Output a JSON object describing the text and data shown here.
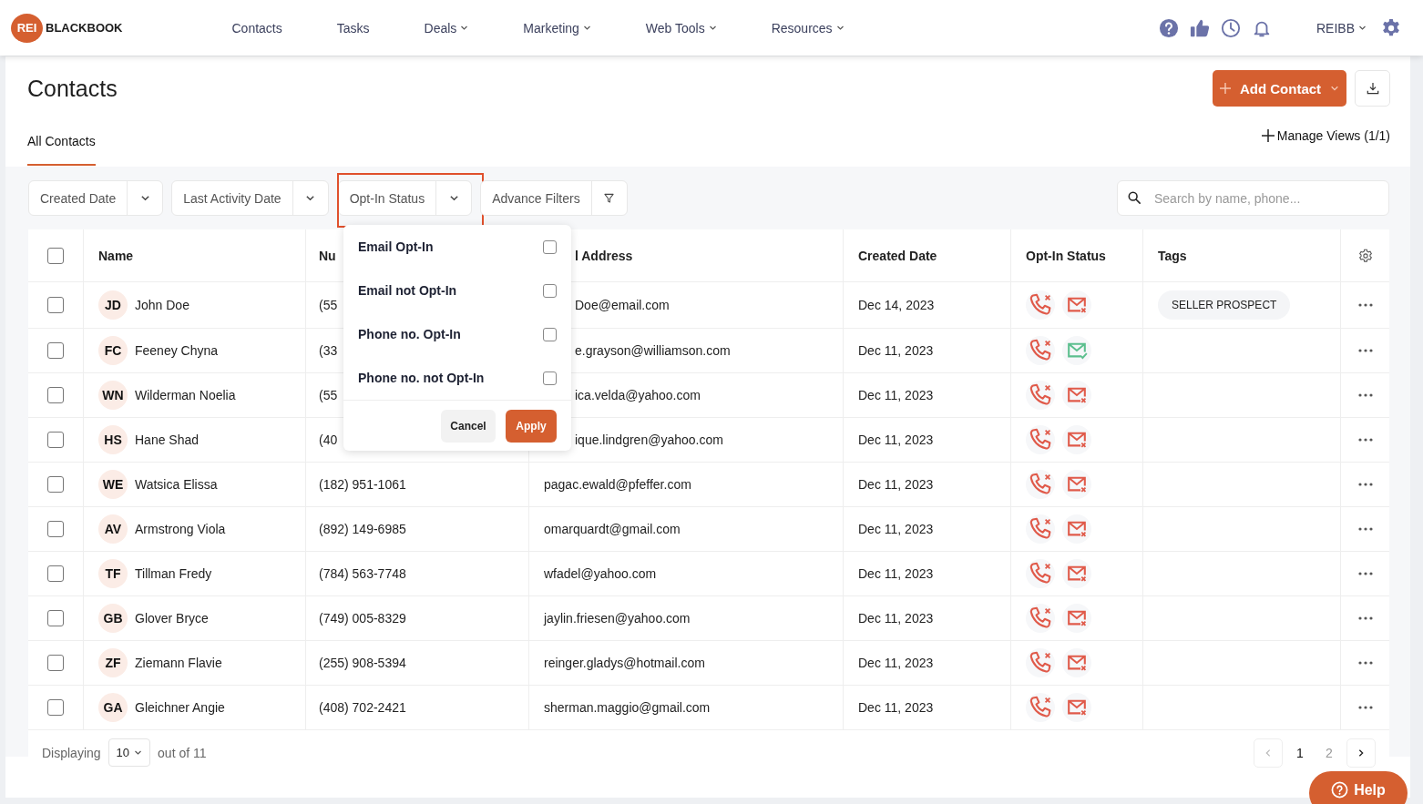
{
  "brand": {
    "badge": "REI",
    "name": "BLACKBOOK"
  },
  "nav": [
    {
      "label": "Contacts",
      "dropdown": false
    },
    {
      "label": "Tasks",
      "dropdown": false
    },
    {
      "label": "Deals",
      "dropdown": true
    },
    {
      "label": "Marketing",
      "dropdown": true
    },
    {
      "label": "Web Tools",
      "dropdown": true
    },
    {
      "label": "Resources",
      "dropdown": true
    }
  ],
  "user": {
    "label": "REIBB"
  },
  "page": {
    "title": "Contacts",
    "add_button": "Add Contact",
    "manage_views": "Manage Views (1/1)"
  },
  "view_tabs": [
    {
      "label": "All Contacts",
      "selected": true
    }
  ],
  "filters": [
    {
      "label": "Created Date",
      "kind": "dropdown",
      "highlighted": false
    },
    {
      "label": "Last Activity Date",
      "kind": "dropdown",
      "highlighted": false
    },
    {
      "label": "Opt-In Status",
      "kind": "dropdown",
      "highlighted": true
    },
    {
      "label": "Advance Filters",
      "kind": "filter",
      "highlighted": false
    }
  ],
  "search": {
    "placeholder": "Search by name, phone..."
  },
  "table": {
    "select_all_checked": false,
    "columns": [
      "Name",
      "Nu",
      "l Address",
      "Created Date",
      "Opt-In Status",
      "Tags"
    ],
    "rows": [
      {
        "initials": "JD",
        "name": "John Doe",
        "phone": "(55",
        "email": "Doe@email.com",
        "created": "Dec 14, 2023",
        "phone_opt_in": false,
        "email_opt_in": false,
        "tags": [
          "SELLER PROSPECT"
        ],
        "checked": false
      },
      {
        "initials": "FC",
        "name": "Feeney Chyna",
        "phone": "(33",
        "email": "e.grayson@williamson.com",
        "created": "Dec 11, 2023",
        "phone_opt_in": false,
        "email_opt_in": true,
        "tags": [],
        "checked": false
      },
      {
        "initials": "WN",
        "name": "Wilderman Noelia",
        "phone": "(55",
        "email": "ica.velda@yahoo.com",
        "created": "Dec 11, 2023",
        "phone_opt_in": false,
        "email_opt_in": false,
        "tags": [],
        "checked": false
      },
      {
        "initials": "HS",
        "name": "Hane Shad",
        "phone": "(40",
        "email": "ique.lindgren@yahoo.com",
        "created": "Dec 11, 2023",
        "phone_opt_in": false,
        "email_opt_in": false,
        "tags": [],
        "checked": false
      },
      {
        "initials": "WE",
        "name": "Watsica Elissa",
        "phone": "(182) 951-1061",
        "email": "pagac.ewald@pfeffer.com",
        "created": "Dec 11, 2023",
        "phone_opt_in": false,
        "email_opt_in": false,
        "tags": [],
        "checked": false
      },
      {
        "initials": "AV",
        "name": "Armstrong Viola",
        "phone": "(892) 149-6985",
        "email": "omarquardt@gmail.com",
        "created": "Dec 11, 2023",
        "phone_opt_in": false,
        "email_opt_in": false,
        "tags": [],
        "checked": false
      },
      {
        "initials": "TF",
        "name": "Tillman Fredy",
        "phone": "(784) 563-7748",
        "email": "wfadel@yahoo.com",
        "created": "Dec 11, 2023",
        "phone_opt_in": false,
        "email_opt_in": false,
        "tags": [],
        "checked": false
      },
      {
        "initials": "GB",
        "name": "Glover Bryce",
        "phone": "(749) 005-8329",
        "email": "jaylin.friesen@yahoo.com",
        "created": "Dec 11, 2023",
        "phone_opt_in": false,
        "email_opt_in": false,
        "tags": [],
        "checked": false
      },
      {
        "initials": "ZF",
        "name": "Ziemann Flavie",
        "phone": "(255) 908-5394",
        "email": "reinger.gladys@hotmail.com",
        "created": "Dec 11, 2023",
        "phone_opt_in": false,
        "email_opt_in": false,
        "tags": [],
        "checked": false
      },
      {
        "initials": "GA",
        "name": "Gleichner Angie",
        "phone": "(408) 702-2421",
        "email": "sherman.maggio@gmail.com",
        "created": "Dec 11, 2023",
        "phone_opt_in": false,
        "email_opt_in": false,
        "tags": [],
        "checked": false
      }
    ]
  },
  "opt_in_menu": {
    "options": [
      {
        "label": "Email Opt-In",
        "checked": false
      },
      {
        "label": "Email not Opt-In",
        "checked": false
      },
      {
        "label": "Phone no. Opt-In",
        "checked": false
      },
      {
        "label": "Phone no. not Opt-In",
        "checked": false
      }
    ],
    "cancel": "Cancel",
    "apply": "Apply"
  },
  "footer": {
    "displaying": "Displaying",
    "page_size": "10",
    "out_of": "out of 11",
    "pages": [
      {
        "label": "1",
        "selected": true
      },
      {
        "label": "2",
        "selected": false
      }
    ]
  },
  "help": {
    "label": "Help"
  }
}
